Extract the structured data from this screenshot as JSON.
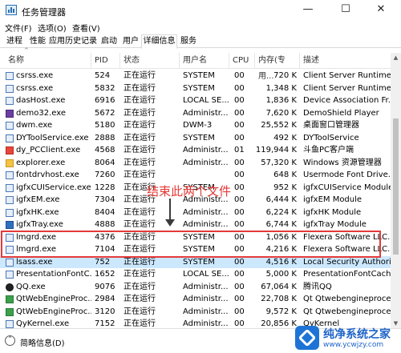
{
  "window": {
    "title": "任务管理器",
    "minimize": "—",
    "maximize": "☐",
    "close": "✕"
  },
  "menu": [
    "文件(F)",
    "选项(O)",
    "查看(V)"
  ],
  "tabs": [
    "进程",
    "性能",
    "应用历史记录",
    "启动",
    "用户",
    "详细信息",
    "服务"
  ],
  "active_tab": "详细信息",
  "columns": [
    "名称",
    "PID",
    "状态",
    "用户名",
    "CPU",
    "内存(专用...",
    "描述"
  ],
  "rows": [
    {
      "name": "csrss.exe",
      "pid": "524",
      "status": "正在运行",
      "user": "SYSTEM",
      "cpu": "00",
      "mem": "720 K",
      "desc": "Client Server Runtime ...",
      "icon": "generic-icon"
    },
    {
      "name": "csrss.exe",
      "pid": "5832",
      "status": "正在运行",
      "user": "SYSTEM",
      "cpu": "00",
      "mem": "1,348 K",
      "desc": "Client Server Runtime ...",
      "icon": "generic-icon"
    },
    {
      "name": "dasHost.exe",
      "pid": "6916",
      "status": "正在运行",
      "user": "LOCAL SE...",
      "cpu": "00",
      "mem": "1,836 K",
      "desc": "Device Association Fr...",
      "icon": "generic-icon"
    },
    {
      "name": "demo32.exe",
      "pid": "5672",
      "status": "正在运行",
      "user": "Administr...",
      "cpu": "00",
      "mem": "7,620 K",
      "desc": "DemoShield Player",
      "icon": "demo-icon"
    },
    {
      "name": "dwm.exe",
      "pid": "5180",
      "status": "正在运行",
      "user": "DWM-3",
      "cpu": "00",
      "mem": "25,552 K",
      "desc": "桌面窗口管理器",
      "icon": "generic-icon"
    },
    {
      "name": "DYToolService.exe",
      "pid": "2888",
      "status": "正在运行",
      "user": "SYSTEM",
      "cpu": "00",
      "mem": "492 K",
      "desc": "DYToolService",
      "icon": "generic-icon"
    },
    {
      "name": "dy_PCClient.exe",
      "pid": "4568",
      "status": "正在运行",
      "user": "Administr...",
      "cpu": "01",
      "mem": "119,944 K",
      "desc": "斗鱼PC客户端",
      "icon": "douyu-icon"
    },
    {
      "name": "explorer.exe",
      "pid": "8064",
      "status": "正在运行",
      "user": "Administr...",
      "cpu": "00",
      "mem": "57,320 K",
      "desc": "Windows 资源管理器",
      "icon": "folder-icon"
    },
    {
      "name": "fontdrvhost.exe",
      "pid": "7260",
      "status": "正在运行",
      "user": "",
      "cpu": "00",
      "mem": "648 K",
      "desc": "Usermode Font Drive...",
      "icon": "generic-icon"
    },
    {
      "name": "igfxCUIService.exe",
      "pid": "1228",
      "status": "正在运行",
      "user": "SYSTEM",
      "cpu": "00",
      "mem": "952 K",
      "desc": "igfxCUIService Module",
      "icon": "generic-icon"
    },
    {
      "name": "igfxEM.exe",
      "pid": "7304",
      "status": "正在运行",
      "user": "Administr...",
      "cpu": "00",
      "mem": "6,444 K",
      "desc": "igfxEM Module",
      "icon": "generic-icon"
    },
    {
      "name": "igfxHK.exe",
      "pid": "8404",
      "status": "正在运行",
      "user": "Administr...",
      "cpu": "00",
      "mem": "6,224 K",
      "desc": "igfxHK Module",
      "icon": "generic-icon"
    },
    {
      "name": "igfxTray.exe",
      "pid": "4888",
      "status": "正在运行",
      "user": "Administr...",
      "cpu": "00",
      "mem": "6,744 K",
      "desc": "igfxTray Module",
      "icon": "igfx-icon"
    },
    {
      "name": "lmgrd.exe",
      "pid": "4376",
      "status": "正在运行",
      "user": "SYSTEM",
      "cpu": "00",
      "mem": "1,056 K",
      "desc": "Flexera Software LLC.",
      "icon": "generic-icon"
    },
    {
      "name": "lmgrd.exe",
      "pid": "7104",
      "status": "正在运行",
      "user": "SYSTEM",
      "cpu": "00",
      "mem": "4,216 K",
      "desc": "Flexera Software LLC.",
      "icon": "generic-icon"
    },
    {
      "name": "lsass.exe",
      "pid": "752",
      "status": "正在运行",
      "user": "SYSTEM",
      "cpu": "00",
      "mem": "4,516 K",
      "desc": "Local Security Authori...",
      "icon": "generic-icon",
      "selected": true
    },
    {
      "name": "PresentationFontC...",
      "pid": "1652",
      "status": "正在运行",
      "user": "LOCAL SE...",
      "cpu": "00",
      "mem": "5,000 K",
      "desc": "PresentationFontCach...",
      "icon": "generic-icon"
    },
    {
      "name": "QQ.exe",
      "pid": "9076",
      "status": "正在运行",
      "user": "Administr...",
      "cpu": "00",
      "mem": "67,064 K",
      "desc": "腾讯QQ",
      "icon": "qq-icon"
    },
    {
      "name": "QtWebEngineProc...",
      "pid": "2984",
      "status": "正在运行",
      "user": "Administr...",
      "cpu": "00",
      "mem": "22,708 K",
      "desc": "Qt Qtwebengineproce...",
      "icon": "qt-icon"
    },
    {
      "name": "QtWebEngineProc...",
      "pid": "3120",
      "status": "正在运行",
      "user": "Administr...",
      "cpu": "00",
      "mem": "9,572 K",
      "desc": "Qt Qtwebengineproce...",
      "icon": "qt-icon"
    },
    {
      "name": "QyKernel.exe",
      "pid": "7152",
      "status": "正在运行",
      "user": "Administr...",
      "cpu": "00",
      "mem": "20,856 K",
      "desc": "QyKernel",
      "icon": "generic-icon"
    }
  ],
  "annotation": "结束此两个文件",
  "footer": {
    "label": "简略信息(D)"
  },
  "watermark": {
    "name": "纯净系统之家",
    "url": "www.ycwjzy.com"
  },
  "colors": {
    "highlight": "#e43a3a",
    "selected_row": "#cce8ff",
    "annotation_text": "#e53935"
  }
}
